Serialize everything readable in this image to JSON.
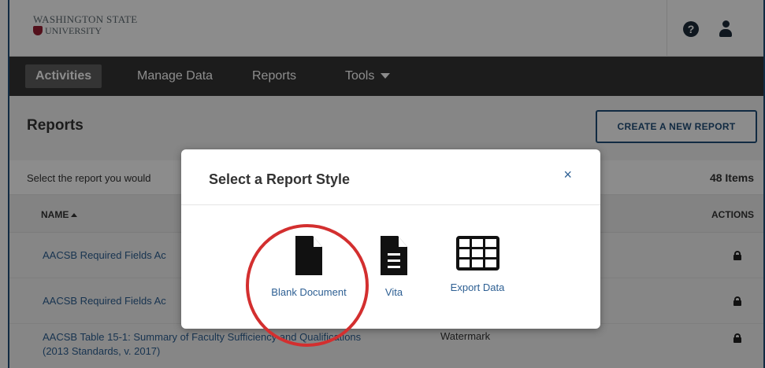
{
  "header": {
    "logo_line1": "WASHINGTON STATE",
    "logo_line2": "UNIVERSITY"
  },
  "nav": {
    "items": [
      {
        "label": "Activities",
        "active": true
      },
      {
        "label": "Manage Data",
        "active": false
      },
      {
        "label": "Reports",
        "active": false
      },
      {
        "label": "Tools",
        "active": false
      }
    ]
  },
  "page": {
    "title": "Reports",
    "create_button": "CREATE A NEW REPORT",
    "info_text": "Select the report you would",
    "item_count": "48 Items",
    "columns": {
      "name": "NAME",
      "actions": "ACTIONS"
    },
    "rows": [
      {
        "name": "AACSB Required Fields Ac",
        "style": ""
      },
      {
        "name": "AACSB Required Fields Ac",
        "style": ""
      },
      {
        "name": "AACSB Table 15-1: Summary of Faculty Sufficiency and Qualifications",
        "name2": "(2013 Standards, v. 2017)",
        "style": "Watermark"
      }
    ]
  },
  "modal": {
    "title": "Select a Report Style",
    "close": "×",
    "options": [
      {
        "label": "Blank Document",
        "icon": "blank-document-icon"
      },
      {
        "label": "Vita",
        "icon": "vita-document-icon"
      },
      {
        "label": "Export Data",
        "icon": "table-grid-icon"
      }
    ]
  },
  "colors": {
    "nav_bg": "#333333",
    "link": "#2d5f93",
    "highlight_circle": "#d32f2f",
    "button_border": "#1f4e79"
  }
}
